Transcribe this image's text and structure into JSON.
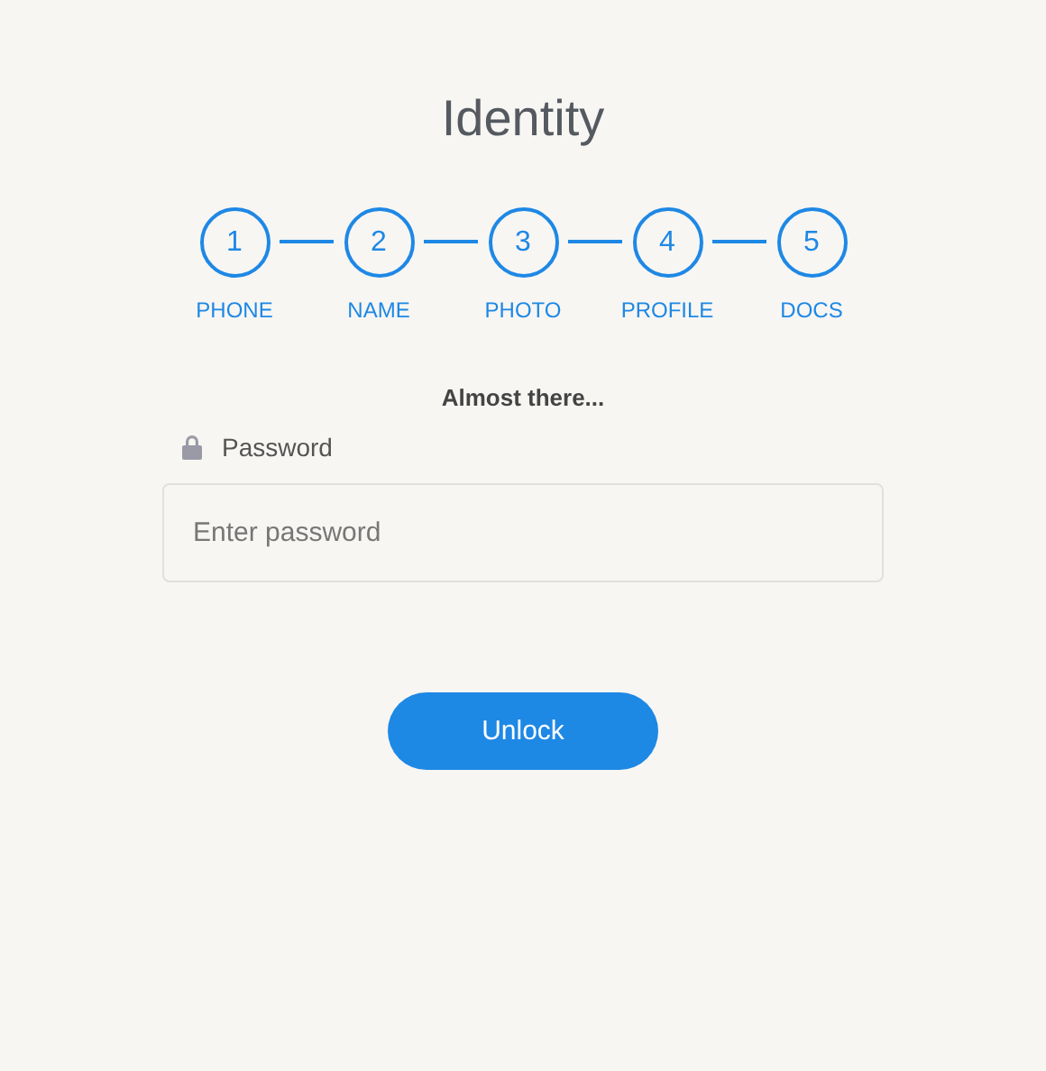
{
  "title": "Identity",
  "steps": [
    {
      "number": "1",
      "label": "PHONE"
    },
    {
      "number": "2",
      "label": "NAME"
    },
    {
      "number": "3",
      "label": "PHOTO"
    },
    {
      "number": "4",
      "label": "PROFILE"
    },
    {
      "number": "5",
      "label": "DOCS"
    }
  ],
  "message": "Almost there...",
  "password": {
    "label": "Password",
    "placeholder": "Enter password"
  },
  "button": "Unlock"
}
